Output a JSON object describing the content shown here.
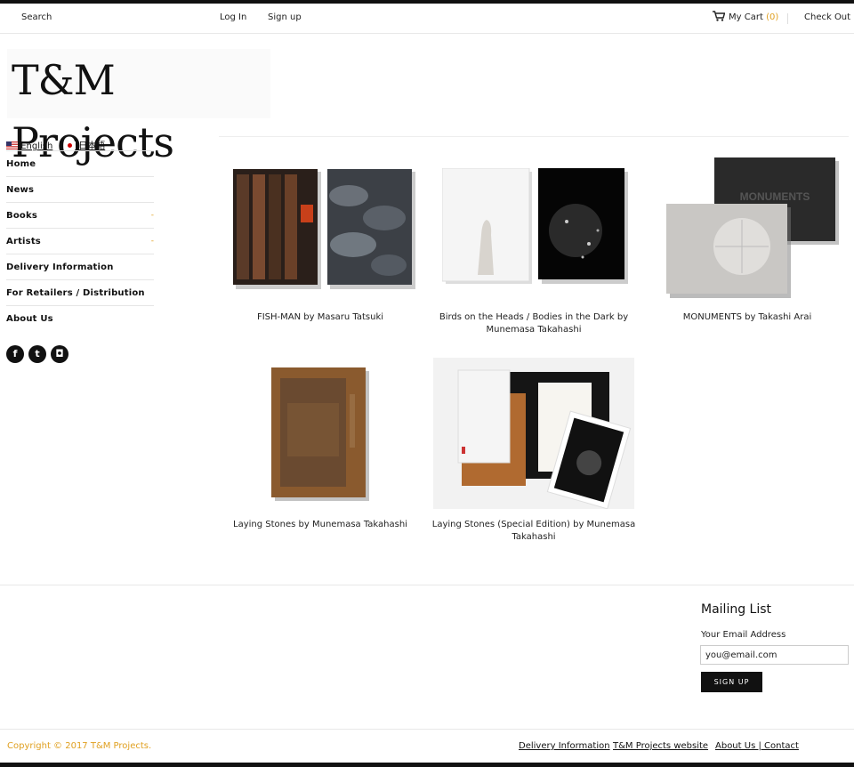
{
  "header": {
    "search_label": "Search",
    "login_label": "Log In",
    "signup_label": "Sign up",
    "cart_label": "My Cart",
    "cart_count": "(0)",
    "checkout_label": "Check Out"
  },
  "brand": {
    "logo_text": "T&M Projects"
  },
  "languages": [
    {
      "label": "English"
    },
    {
      "label": "日本語"
    }
  ],
  "nav": {
    "items": [
      {
        "label": "Home",
        "dropdown": ""
      },
      {
        "label": "News",
        "dropdown": ""
      },
      {
        "label": "Books",
        "dropdown": "-"
      },
      {
        "label": "Artists",
        "dropdown": "-"
      },
      {
        "label": "Delivery Information",
        "dropdown": ""
      },
      {
        "label": "For Retailers / Distribution",
        "dropdown": ""
      },
      {
        "label": "About Us",
        "dropdown": ""
      }
    ]
  },
  "social": {
    "facebook": "f",
    "twitter": "t",
    "instagram": "◘"
  },
  "products": [
    {
      "title": "FISH-MAN by Masaru Tatsuki"
    },
    {
      "title": "Birds on the Heads / Bodies in the Dark by Munemasa Takahashi"
    },
    {
      "title": "MONUMENTS by Takashi Arai"
    },
    {
      "title": "Laying Stones by Munemasa Takahashi"
    },
    {
      "title": "Laying Stones (Special Edition) by Munemasa Takahashi"
    }
  ],
  "book_text": {
    "monuments_cover": "MONUMENTS"
  },
  "mailing": {
    "title": "Mailing List",
    "label": "Your Email Address",
    "placeholder": "you@email.com",
    "button": "SIGN UP"
  },
  "footer": {
    "copyright": "Copyright © 2017 T&M Projects.",
    "links": [
      "Delivery Information",
      "T&M Projects website",
      "About Us | Contact"
    ]
  },
  "colors": {
    "accent": "#e0a020",
    "text": "#222222",
    "dark": "#111111"
  }
}
